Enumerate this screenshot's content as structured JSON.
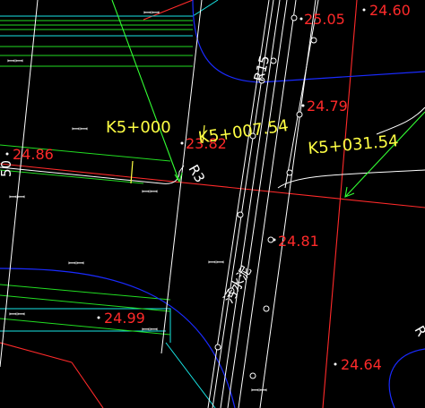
{
  "colors": {
    "background": "#000000",
    "red": "#ff2a2a",
    "white": "#ffffff",
    "cyan": "#19e6e6",
    "green": "#22dd22",
    "blue": "#1a2bff",
    "yellow": "#ffff44",
    "leader_green": "#33ff33"
  },
  "stations": {
    "k5_000": "K5+000",
    "k5_007": "K5+007.54",
    "k5_031": "K5+031.54"
  },
  "elevations": {
    "e2505": "25.05",
    "e2460": "24.60",
    "e2479": "24.79",
    "e2382": "23.82",
    "e2486": "24.86",
    "e2481": "24.81",
    "e2499": "24.99",
    "e2464": "24.64"
  },
  "annotations": {
    "r3": "R3",
    "r15": "R15",
    "pipe": "污水泥",
    "side_left": "50",
    "side_right": "R"
  },
  "symbols": {
    "grass": "ꟷ"
  }
}
